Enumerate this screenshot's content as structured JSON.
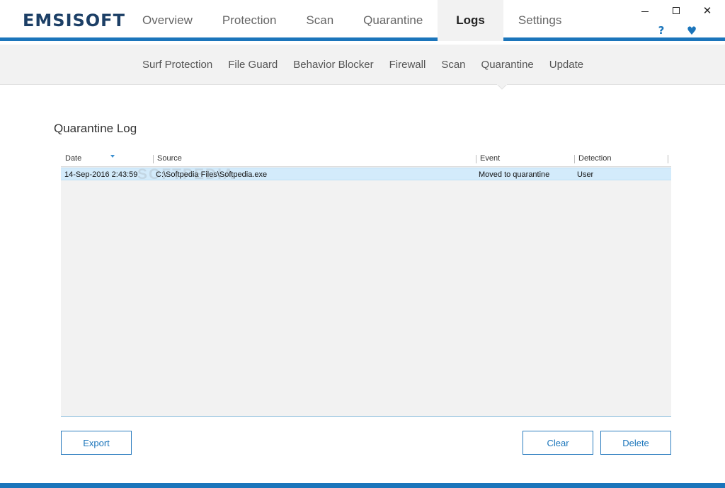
{
  "app": {
    "logo": "EMSISOFT",
    "colors": {
      "accent": "#1b75bb",
      "logo": "#1c3f66",
      "selected_row": "#d3ebfb"
    }
  },
  "main_nav": {
    "tabs": [
      {
        "label": "Overview"
      },
      {
        "label": "Protection"
      },
      {
        "label": "Scan"
      },
      {
        "label": "Quarantine"
      },
      {
        "label": "Logs",
        "active": true
      },
      {
        "label": "Settings"
      }
    ]
  },
  "window_controls": {
    "close_glyph": "✕",
    "help_glyph": "?",
    "heart_glyph": "♥",
    "icons": [
      "minimize-icon",
      "maximize-icon",
      "close-icon",
      "help-icon",
      "heart-icon"
    ]
  },
  "sub_nav": {
    "items": [
      {
        "label": "Surf Protection"
      },
      {
        "label": "File Guard"
      },
      {
        "label": "Behavior Blocker"
      },
      {
        "label": "Firewall"
      },
      {
        "label": "Scan"
      },
      {
        "label": "Quarantine",
        "active": true
      },
      {
        "label": "Update"
      }
    ]
  },
  "page": {
    "title": "Quarantine Log"
  },
  "table": {
    "columns": [
      "Date",
      "Source",
      "Event",
      "Detection"
    ],
    "sorted_by": "Date",
    "rows": [
      {
        "date": "14-Sep-2016 2:43:59",
        "source": "C:\\Softpedia Files\\Softpedia.exe",
        "event": "Moved to quarantine",
        "detection": "User",
        "selected": true
      }
    ]
  },
  "watermark": "SOFTPEDIA",
  "buttons": {
    "export": "Export",
    "clear": "Clear",
    "delete": "Delete"
  }
}
